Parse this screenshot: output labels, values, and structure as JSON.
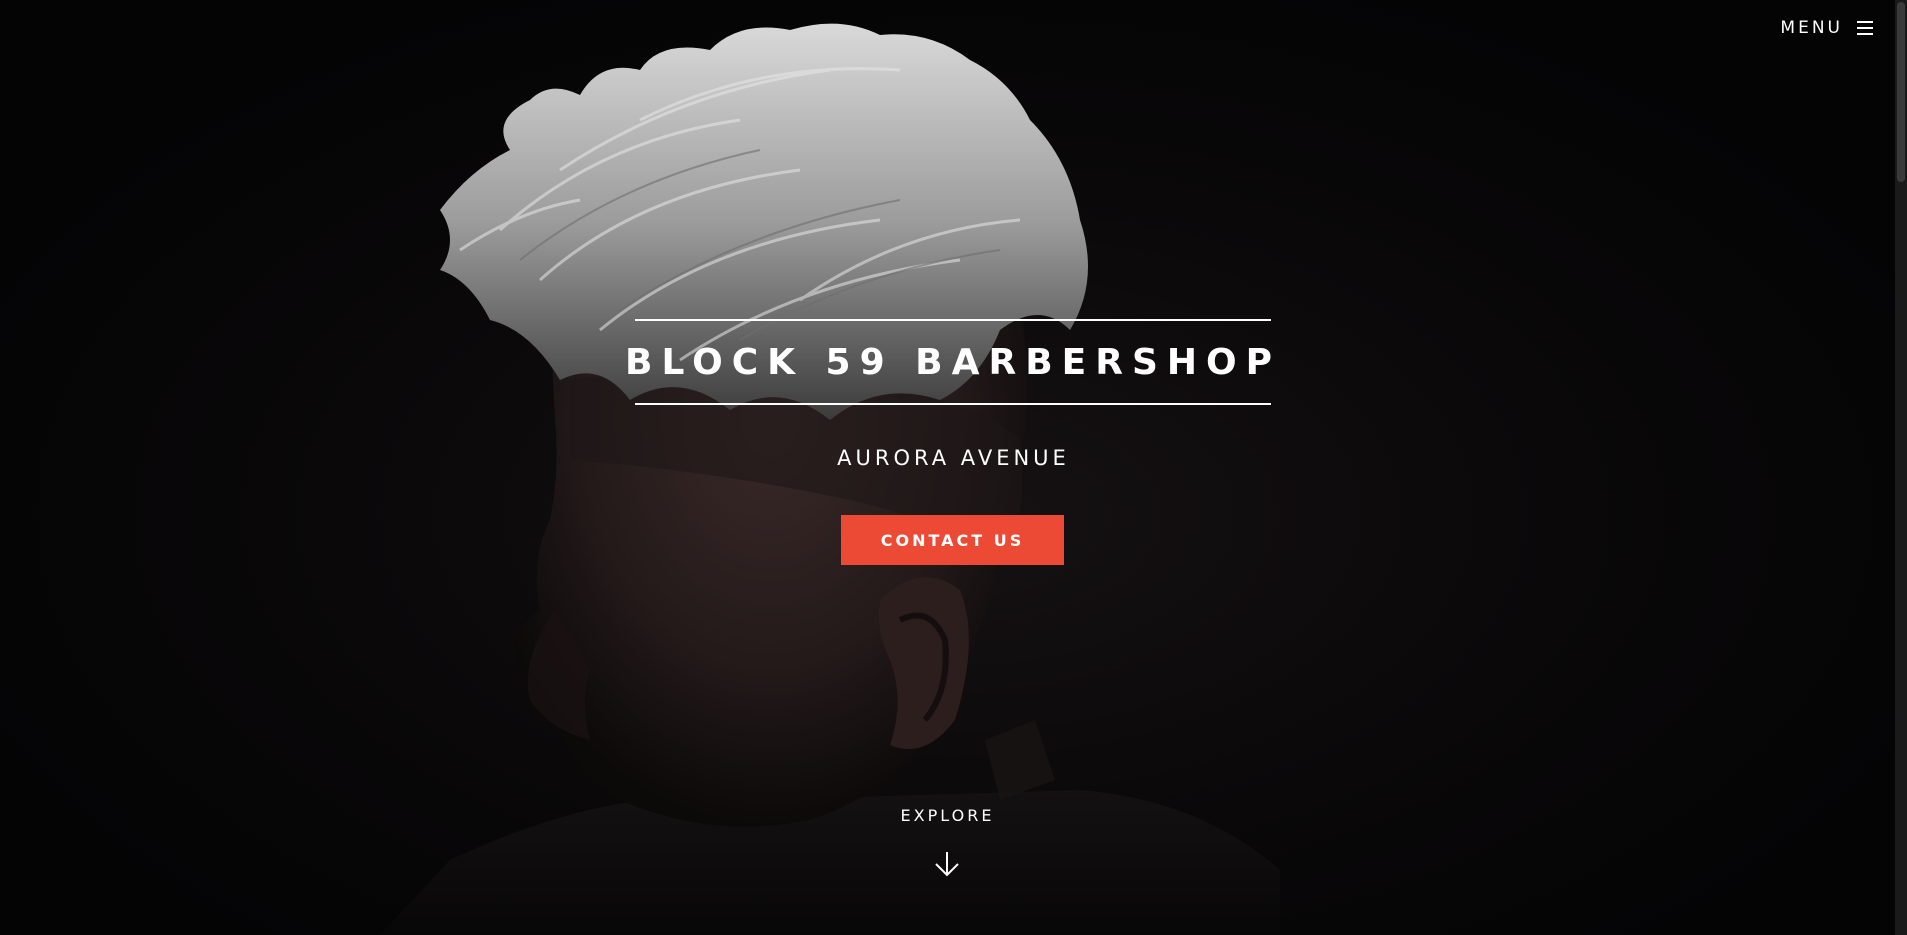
{
  "nav": {
    "menu_label": "MENU",
    "menu_icon": "hamburger-icon"
  },
  "hero": {
    "title": "BLOCK 59 BARBERSHOP",
    "subtitle": "AURORA AVENUE",
    "cta_label": "CONTACT US",
    "explore_label": "EXPLORE",
    "explore_icon": "arrow-down-icon"
  },
  "colors": {
    "accent": "#ec4a35",
    "background": "#050506",
    "text": "#ffffff"
  }
}
